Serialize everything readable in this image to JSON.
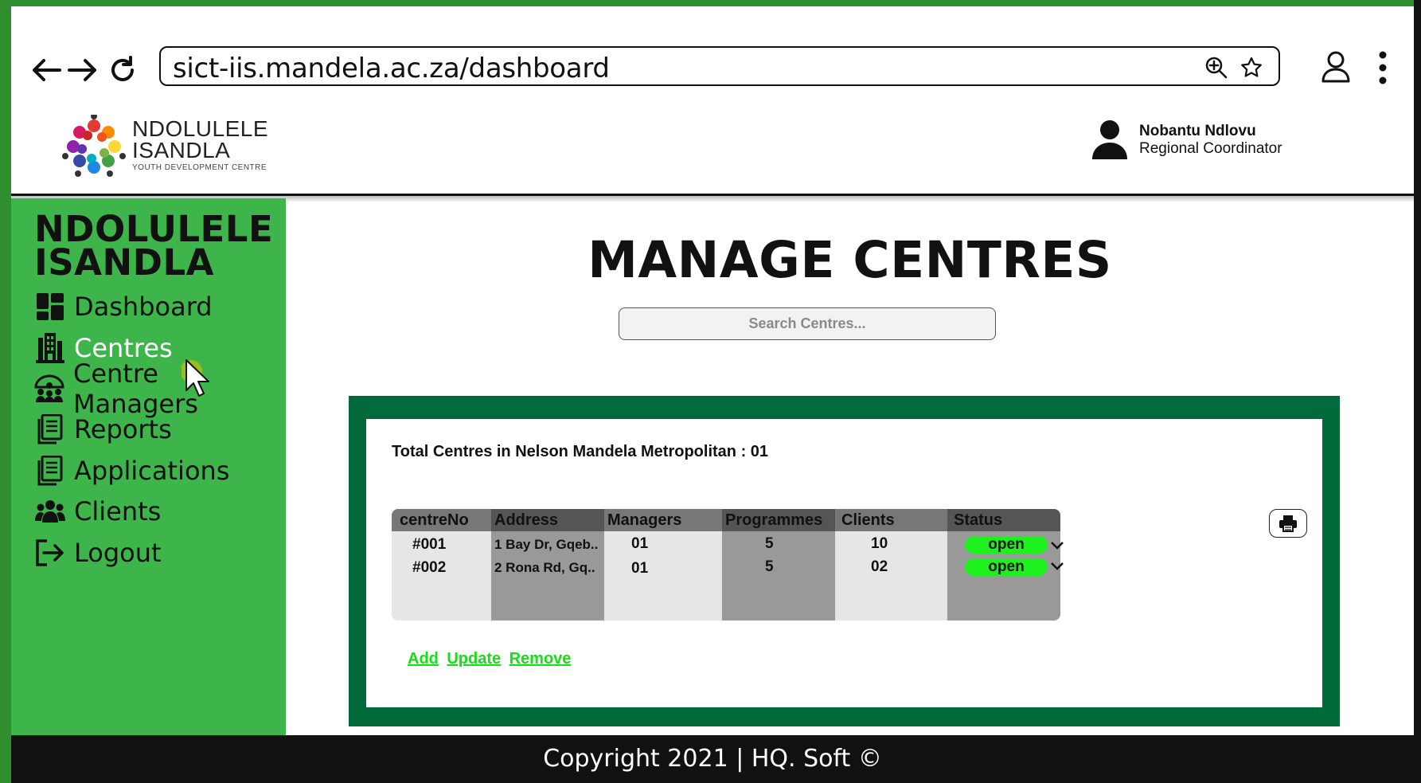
{
  "browser": {
    "url": "sict-iis.mandela.ac.za/dashboard"
  },
  "header": {
    "logo_line1": "NDOLULELE",
    "logo_line2": "ISANDLA",
    "logo_sub": "YOUTH DEVELOPMENT CENTRE",
    "user_name": "Nobantu Ndlovu",
    "user_role": "Regional Coordinator"
  },
  "sidebar": {
    "brand_line1": "NDOLULELE",
    "brand_line2": "ISANDLA",
    "items": [
      {
        "label": "Dashboard",
        "icon": "dashboard-icon"
      },
      {
        "label": "Centres",
        "icon": "building-icon",
        "active": true
      },
      {
        "label": "Centre Managers",
        "icon": "managers-icon"
      },
      {
        "label": "Reports",
        "icon": "report-icon"
      },
      {
        "label": "Applications",
        "icon": "applications-icon"
      },
      {
        "label": "Clients",
        "icon": "clients-icon"
      },
      {
        "label": "Logout",
        "icon": "logout-icon"
      }
    ]
  },
  "main": {
    "title": "MANAGE CENTRES",
    "search_placeholder": "Search Centres...",
    "total_label": "Total Centres in Nelson Mandela Metropolitan : 01",
    "table": {
      "headers": [
        "centreNo",
        "Address",
        "Managers",
        "Programmes",
        "Clients",
        "Status"
      ],
      "rows": [
        {
          "centreNo": "#001",
          "address": "1 Bay Dr, Gqeb..",
          "managers": "01",
          "programmes": "5",
          "clients": "10",
          "status": "open"
        },
        {
          "centreNo": "#002",
          "address": "2 Rona Rd, Gq..",
          "managers": "01",
          "programmes": "5",
          "clients": "02",
          "status": "open"
        }
      ]
    },
    "actions": {
      "add": "Add",
      "update": "Update",
      "remove": "Remove"
    }
  },
  "footer": {
    "text": "Copyright 2021 | HQ. Soft ©"
  },
  "colors": {
    "sidebar_bg": "#3db54a",
    "panel_bg": "#006a3a",
    "status_open": "#1ef01e",
    "link_green": "#14e014"
  }
}
